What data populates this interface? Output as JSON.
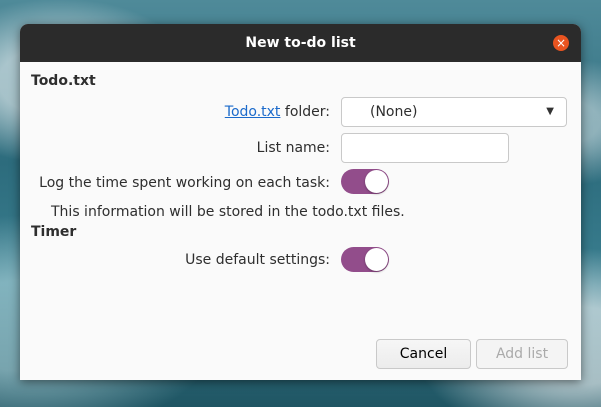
{
  "dialog": {
    "title": "New to-do list",
    "close_symbol": "×",
    "todo_section": {
      "heading": "Todo.txt",
      "folder_link": "Todo.txt",
      "folder_label": " folder:",
      "folder_value": "(None)",
      "list_name_label": "List name:",
      "list_name_value": "",
      "log_time_label": "Log the time spent working on each task:",
      "log_time_enabled": true,
      "info_text": "This information will be stored in the todo.txt files."
    },
    "timer_section": {
      "heading": "Timer",
      "default_settings_label": "Use default settings:",
      "default_settings_enabled": true
    },
    "buttons": {
      "cancel": "Cancel",
      "add": "Add list"
    }
  },
  "colors": {
    "accent": "#924d8b",
    "close": "#e95420",
    "titlebar": "#2b2b2b"
  },
  "icons": {
    "close": "close-icon",
    "dropdown": "chevron-down-icon"
  }
}
